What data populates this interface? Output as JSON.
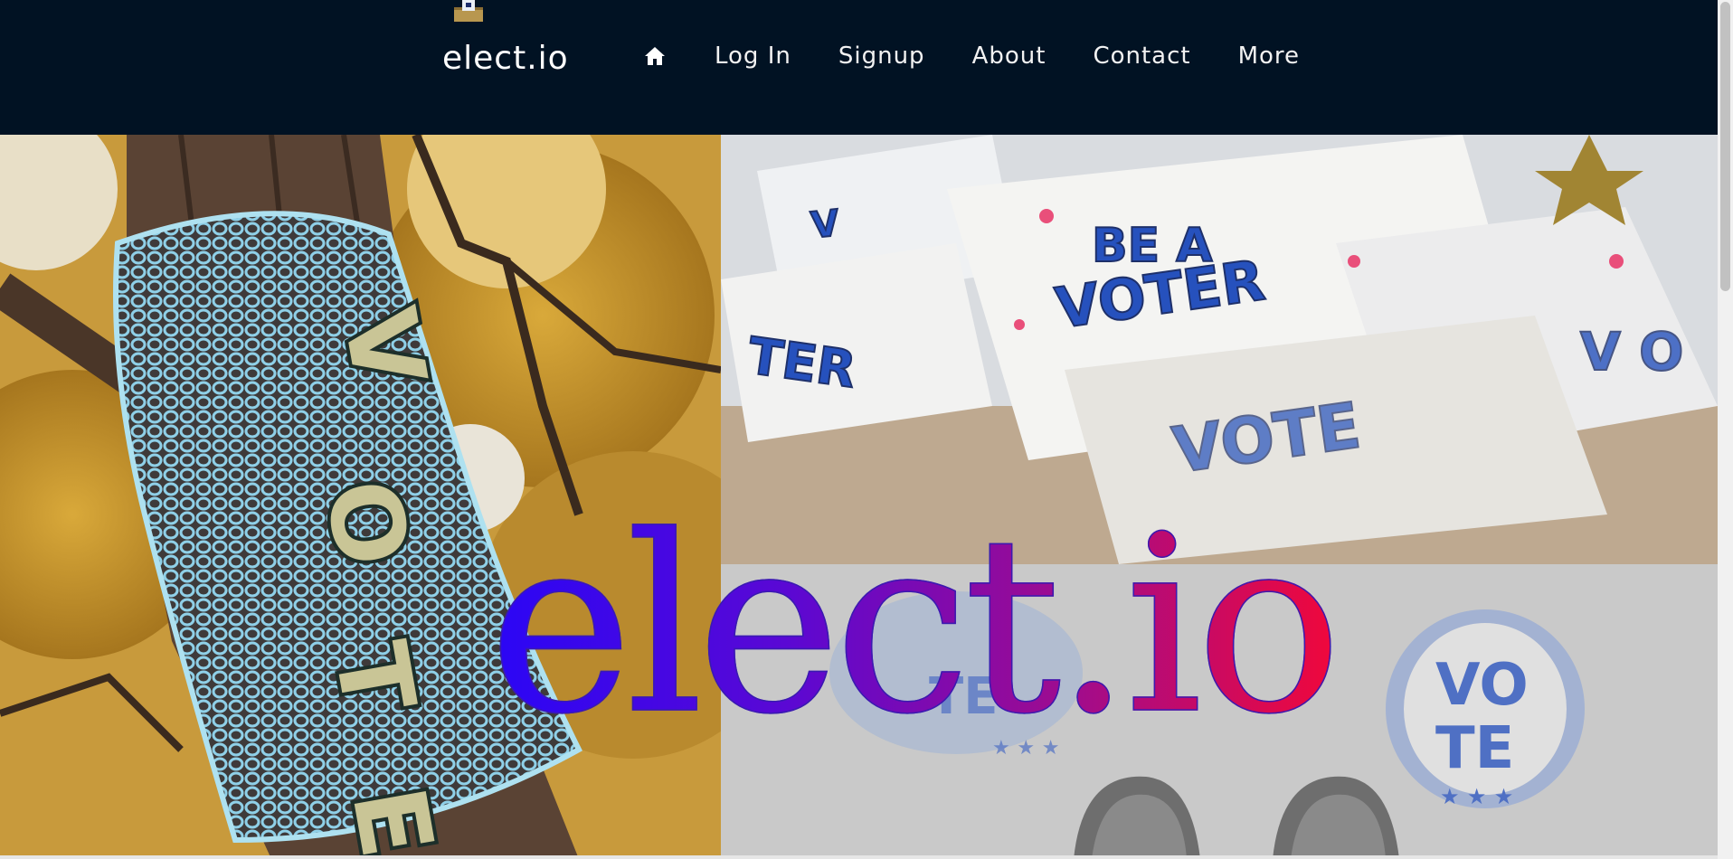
{
  "brand": {
    "name": "elect.io",
    "icon": "ballot-box-icon"
  },
  "nav": {
    "home_icon": "home-icon",
    "items": [
      {
        "label": "Log In"
      },
      {
        "label": "Signup"
      },
      {
        "label": "About"
      },
      {
        "label": "Contact"
      },
      {
        "label": "More"
      }
    ]
  },
  "hero": {
    "title": "elect.io",
    "title_gradient": [
      "#2a06f6",
      "#f0083b"
    ],
    "photos": [
      {
        "subject": "crocheted-vote-tree-wrap"
      },
      {
        "subject": "be-a-voter-cards"
      },
      {
        "subject": "vote-sidewalk-stencil"
      }
    ]
  },
  "colors": {
    "navbar": "#011223",
    "nav_text": "#f2f2f2"
  }
}
